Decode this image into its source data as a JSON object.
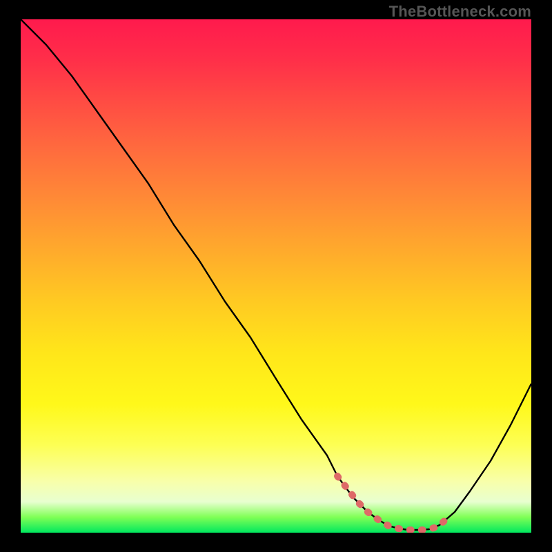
{
  "watermark": "TheBottleneck.com",
  "chart_data": {
    "type": "line",
    "title": "",
    "xlabel": "",
    "ylabel": "",
    "xlim": [
      0,
      100
    ],
    "ylim": [
      0,
      100
    ],
    "series": [
      {
        "name": "curve",
        "x": [
          0,
          5,
          10,
          15,
          20,
          25,
          30,
          35,
          40,
          45,
          50,
          55,
          60,
          62,
          65,
          68,
          70,
          72,
          74,
          76,
          78,
          80,
          82,
          85,
          88,
          92,
          96,
          100
        ],
        "y": [
          100,
          95,
          89,
          82,
          75,
          68,
          60,
          53,
          45,
          38,
          30,
          22,
          15,
          11,
          7,
          4,
          2.5,
          1.4,
          0.8,
          0.5,
          0.5,
          0.7,
          1.5,
          4,
          8,
          14,
          21,
          29
        ]
      },
      {
        "name": "trough-highlight",
        "x": [
          62,
          64,
          66,
          68,
          70,
          71,
          72,
          73,
          74,
          75,
          76,
          77,
          78,
          79,
          80,
          81,
          82,
          83
        ],
        "y": [
          11,
          8.5,
          6,
          4,
          2.5,
          2,
          1.4,
          1,
          0.8,
          0.6,
          0.5,
          0.5,
          0.5,
          0.6,
          0.7,
          1,
          1.5,
          2.3
        ]
      }
    ],
    "colors": {
      "gradient_top": "#ff1a4d",
      "gradient_bottom": "#00e85e",
      "curve": "#000000",
      "trough": "#de6a67"
    }
  }
}
